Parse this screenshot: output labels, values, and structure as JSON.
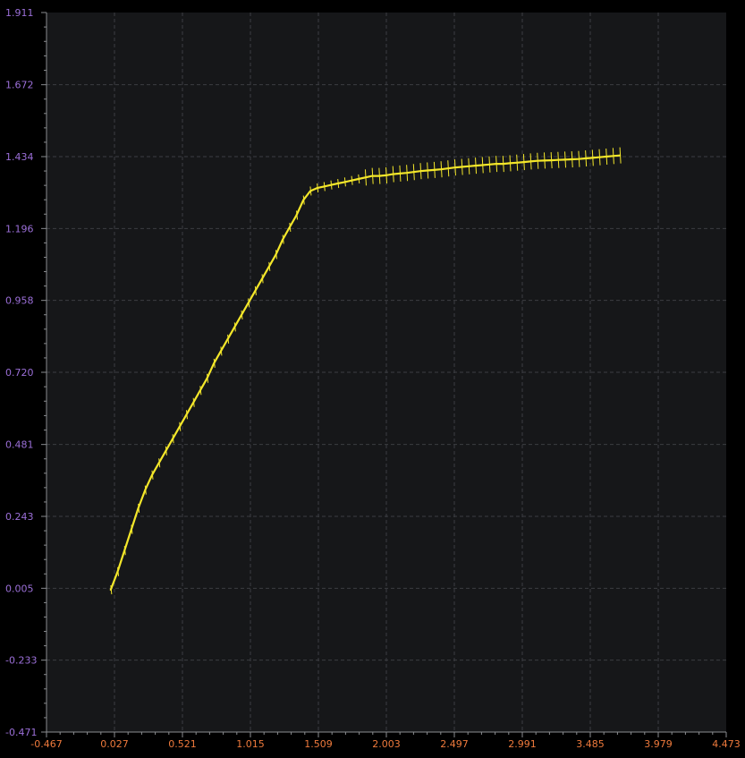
{
  "theme": {
    "background": "#000000",
    "plot_background": "#161719",
    "grid_color": "#3c3e42",
    "axis_color": "#8a8c90",
    "y_tick_color": "#9b6fd8",
    "x_tick_color": "#ef7a3c",
    "series_color": "#f4e72a"
  },
  "chart_data": {
    "type": "line",
    "title": "",
    "xlabel": "",
    "ylabel": "",
    "grid": true,
    "legend": "none",
    "xlim": [
      -0.467,
      4.473
    ],
    "ylim": [
      -0.471,
      1.911
    ],
    "x_ticks": [
      -0.467,
      0.027,
      0.521,
      1.015,
      1.509,
      2.003,
      2.497,
      2.991,
      3.485,
      3.979,
      4.473
    ],
    "x_tick_labels": [
      "-0.467",
      "0.027",
      "0.521",
      "1.015",
      "1.509",
      "2.003",
      "2.497",
      "2.991",
      "3.485",
      "3.979",
      "4.473"
    ],
    "y_ticks": [
      -0.471,
      -0.233,
      0.005,
      0.243,
      0.481,
      0.72,
      0.958,
      1.196,
      1.434,
      1.672,
      1.911
    ],
    "y_tick_labels": [
      "-0.471",
      "-0.233",
      "0.005",
      "0.243",
      "0.481",
      "0.720",
      "0.958",
      "1.196",
      "1.434",
      "1.672",
      "1.911"
    ],
    "series": [
      {
        "color": "#f4e72a",
        "x": [
          0.0,
          0.05,
          0.1,
          0.15,
          0.2,
          0.25,
          0.3,
          0.35,
          0.4,
          0.45,
          0.5,
          0.55,
          0.6,
          0.65,
          0.7,
          0.75,
          0.8,
          0.85,
          0.9,
          0.95,
          1.0,
          1.05,
          1.1,
          1.15,
          1.2,
          1.25,
          1.3,
          1.35,
          1.4,
          1.45,
          1.5,
          1.55,
          1.6,
          1.65,
          1.7,
          1.75,
          1.8,
          1.85,
          1.9,
          1.95,
          2.0,
          2.05,
          2.1,
          2.15,
          2.2,
          2.25,
          2.3,
          2.35,
          2.4,
          2.45,
          2.5,
          2.55,
          2.6,
          2.65,
          2.7,
          2.75,
          2.8,
          2.85,
          2.9,
          2.95,
          3.0,
          3.05,
          3.1,
          3.15,
          3.2,
          3.25,
          3.3,
          3.35,
          3.4,
          3.45,
          3.5,
          3.55,
          3.6,
          3.65,
          3.7
        ],
        "y": [
          0.0,
          0.06,
          0.13,
          0.2,
          0.27,
          0.33,
          0.38,
          0.42,
          0.46,
          0.5,
          0.54,
          0.58,
          0.62,
          0.66,
          0.7,
          0.75,
          0.79,
          0.83,
          0.87,
          0.91,
          0.95,
          0.99,
          1.03,
          1.07,
          1.11,
          1.16,
          1.2,
          1.24,
          1.29,
          1.32,
          1.33,
          1.335,
          1.34,
          1.345,
          1.35,
          1.355,
          1.36,
          1.365,
          1.37,
          1.37,
          1.372,
          1.376,
          1.378,
          1.38,
          1.383,
          1.386,
          1.388,
          1.39,
          1.392,
          1.395,
          1.398,
          1.4,
          1.402,
          1.404,
          1.406,
          1.408,
          1.41,
          1.41,
          1.412,
          1.414,
          1.416,
          1.418,
          1.42,
          1.421,
          1.422,
          1.423,
          1.424,
          1.425,
          1.426,
          1.428,
          1.43,
          1.432,
          1.434,
          1.436,
          1.438
        ]
      }
    ]
  }
}
